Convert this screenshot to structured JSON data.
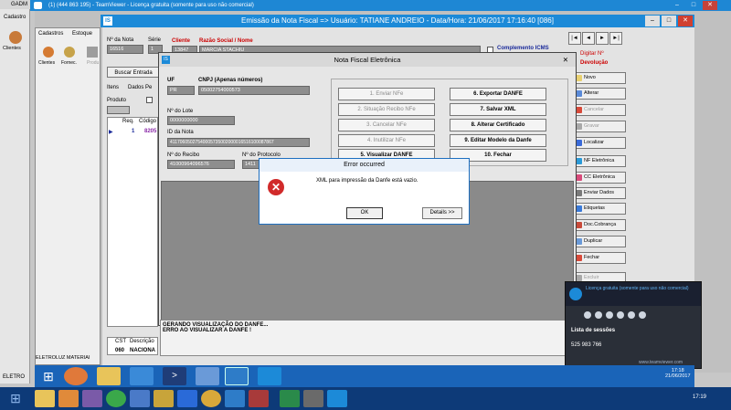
{
  "gadm": {
    "title": "GADM",
    "side_label": "Cadastro",
    "side_item": "Clientes",
    "status": "ELETRO"
  },
  "teamviewer": {
    "title": "(1) (444 863 195) - TeamViewer - Licença gratuita (somente para uso não comercial)"
  },
  "main": {
    "title": "Emissão da Nota Fiscal  => Usuário: TATIANE ANDREIO - Data/Hora: 21/06/2017 17:16:40  [0",
    "title_suffix": "86]",
    "menu": [
      "Cadastros",
      "Estoque"
    ],
    "toolbar": [
      "Clientes",
      "Fornec.",
      "Produ"
    ],
    "nota_label": "Nº da Nota",
    "nota_value": "16516",
    "serie_label": "Série",
    "serie_value": "1",
    "cliente_label": "Cliente",
    "razao_label": "Razão Social / Nome",
    "cliente_code": "13847",
    "cliente_name": "MARCIA STACHIU",
    "complemento_label": "Complemento ICMS",
    "digitar_label": "Digitar Nº",
    "devolucao_label": "Devolução",
    "buscar_label": "Buscar Entrada",
    "tabs": [
      "Itens",
      "Dados Pe"
    ],
    "produto_label": "Produto",
    "grid_headers": [
      "Req.",
      "Código"
    ],
    "grid_row": [
      "1",
      "8205"
    ],
    "cst_headers": [
      "CST",
      "Descrição"
    ],
    "cst_row": [
      "060",
      "NACIONA"
    ],
    "footer_left": "ELETROLUZ MATERIAI",
    "nav": [
      "|◄",
      "◄",
      "►",
      "►|"
    ],
    "right_buttons": [
      {
        "label": "Novo",
        "enabled": true
      },
      {
        "label": "Alterar",
        "enabled": true
      },
      {
        "label": "Cancelar",
        "enabled": false
      },
      {
        "label": "Gravar",
        "enabled": false
      },
      {
        "label": "Localizar",
        "enabled": true
      },
      {
        "label": "NF Eletrônica",
        "enabled": true
      },
      {
        "label": "CC Eletrônica",
        "enabled": true
      },
      {
        "label": "Enviar Dados",
        "enabled": true
      },
      {
        "label": "Etiquetas",
        "enabled": true
      },
      {
        "label": "Doc.Cobrança",
        "enabled": true
      },
      {
        "label": "Duplicar",
        "enabled": true
      },
      {
        "label": "Fechar",
        "enabled": true
      },
      {
        "label": "Excluir",
        "enabled": false
      }
    ]
  },
  "nfe": {
    "title": "Nota Fiscal Eletrônica",
    "uf_label": "UF",
    "uf_value": "PR",
    "cnpj_label": "CNPJ (Apenas números)",
    "cnpj_value": "05002754000573",
    "lote_label": "Nº do Lote",
    "lote_value": "0000000000",
    "id_label": "ID da Nota",
    "id_value": "41170605027540005735002000016516100087867",
    "recibo_label": "Nº do Recibo",
    "recibo_value": "41000964096576",
    "protocolo_label": "Nº do Protocolo",
    "protocolo_value": "1411",
    "buttons_left": [
      {
        "label": "1. Enviar NFe",
        "enabled": false
      },
      {
        "label": "2. Situação Recibo NFe",
        "enabled": false
      },
      {
        "label": "3. Cancelar NFe",
        "enabled": false
      },
      {
        "label": "4. Inutilizar NFe",
        "enabled": false
      },
      {
        "label": "5. Visualizar DANFE",
        "enabled": true
      }
    ],
    "buttons_right": [
      {
        "label": "6. Exportar DANFE",
        "enabled": true
      },
      {
        "label": "7. Salvar XML",
        "enabled": true
      },
      {
        "label": "8. Alterar Certificado",
        "enabled": true
      },
      {
        "label": "9. Editar Modelo da Danfe",
        "enabled": true
      },
      {
        "label": "10. Fechar",
        "enabled": true
      }
    ],
    "log": [
      "GERANDO VISUALIZAÇÃO DO DANFE...",
      "ERRO AO VISUALIZAR A DANFE !"
    ]
  },
  "error": {
    "title": "Error occurred",
    "message": "XML para impressão da Danfe está vazio.",
    "ok": "OK",
    "details": "Details >>"
  },
  "teamviewer_panel": {
    "header": "Licença gratuita (somente para uso não comercial)",
    "list_title": "Lista de sessões",
    "session": "525 983 766",
    "link": "www.teamviewer.com"
  },
  "remote_clock": {
    "time": "17:18",
    "date": "21/06/2017"
  },
  "local_clock": {
    "time": "17:19"
  }
}
